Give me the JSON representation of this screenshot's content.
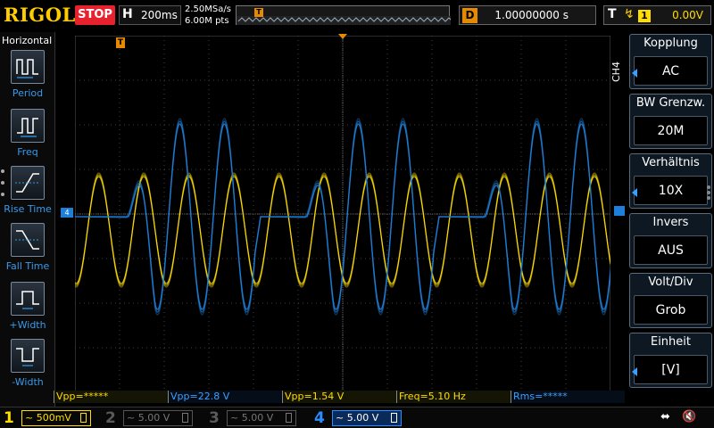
{
  "brand": "RIGOL",
  "run_state": "STOP",
  "horizontal": {
    "label": "H",
    "timebase": "200ms",
    "sample_rate": "2.50MSa/s",
    "memory_depth": "6.00M pts"
  },
  "delay": {
    "label": "D",
    "value": "1.00000000 s"
  },
  "trigger": {
    "label": "T",
    "edge_icon": "rising-edge-icon",
    "channel": "1",
    "level": "0.00V"
  },
  "left_toolbar": {
    "title": "Horizontal",
    "items": [
      {
        "label": "Period",
        "icon": "period-icon"
      },
      {
        "label": "Freq",
        "icon": "freq-icon"
      },
      {
        "label": "Rise Time",
        "icon": "rise-time-icon"
      },
      {
        "label": "Fall Time",
        "icon": "fall-time-icon"
      },
      {
        "label": "+Width",
        "icon": "positive-width-icon"
      },
      {
        "label": "-Width",
        "icon": "negative-width-icon"
      }
    ]
  },
  "channel_menu": {
    "channel_label": "CH4",
    "items": [
      {
        "title": "Kopplung",
        "value": "AC",
        "has_arrow": true
      },
      {
        "title": "BW Grenzw.",
        "value": "20M",
        "has_arrow": false
      },
      {
        "title": "Verhältnis",
        "value": "10X",
        "has_arrow": true
      },
      {
        "title": "Invers",
        "value": "AUS",
        "has_arrow": false
      },
      {
        "title": "Volt/Div",
        "value": "Grob",
        "has_arrow": false
      },
      {
        "title": "Einheit",
        "value": "[V]",
        "has_arrow": true
      }
    ]
  },
  "measurements": [
    {
      "text": "Vpp=*****",
      "color": "yellow"
    },
    {
      "text": "Vpp=22.8 V",
      "color": "blue"
    },
    {
      "text": "Vpp=1.54 V",
      "color": "yellow"
    },
    {
      "text": "Freq=5.10 Hz",
      "color": "yellow"
    },
    {
      "text": "Rms=*****",
      "color": "blue"
    }
  ],
  "channels": [
    {
      "num": "1",
      "scale": "~ 500mV",
      "color": "#ffdd00",
      "active": true
    },
    {
      "num": "2",
      "scale": "~ 5.00 V",
      "color": "#5a5a5a",
      "active": false
    },
    {
      "num": "3",
      "scale": "~  5.00 V",
      "color": "#5a5a5a",
      "active": false
    },
    {
      "num": "4",
      "scale": "~ 5.00 V",
      "color": "#2a8cff",
      "active": true
    }
  ],
  "markers": {
    "trigger_pos": "T",
    "ch4_offset": "4"
  },
  "colors": {
    "ch1": "#ffdd00",
    "ch4": "#1e7fd8",
    "trigger": "#e68a00",
    "grid": "#404040"
  }
}
